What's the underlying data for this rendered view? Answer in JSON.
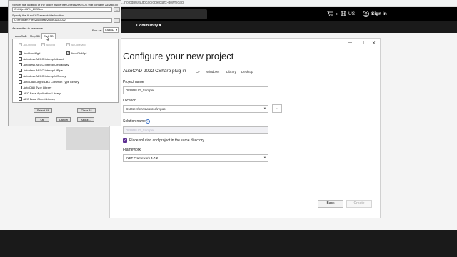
{
  "browser": {
    "url": "...nologies/autocad/objectarx-download"
  },
  "site_header": {
    "cart_count": "0",
    "region": "US",
    "signin": "Sign in",
    "nav_item": "Community ▾"
  },
  "vs_window": {
    "title": "Configure your new project",
    "template_name": "AutoCAD 2022 CSharp plug-in",
    "template_tags": [
      "C#",
      "Windows",
      "Library",
      "Desktop"
    ],
    "project_name_label": "Project name",
    "project_name_value": "DFWBIUG_Sample",
    "location_label": "Location",
    "location_value": "C:\\Users\\chris\\source\\repos",
    "browse_label": "...",
    "solution_name_label": "Solution name",
    "solution_name_value": "DFWBIUG_Sample",
    "same_dir_label": "Place solution and project in the same directory",
    "framework_label": "Framework",
    "framework_value": ".NET Framework 4.7.2",
    "back_button": "Back",
    "create_button": "Create"
  },
  "wizard": {
    "sdk_prompt": "Specify the location of the folder inside the ObjectARX SDK that contains AcMgd.dll",
    "sdk_path": "C:\\ObjectARX_2022\\inc",
    "exe_prompt": "Specify the AutoCAD executable location",
    "exe_path": "C:\\Program Files\\Autodesk\\AutoCAD 2022",
    "browse_label": "...",
    "assemblies_label": "Assemblies to reference",
    "run_as_label": "Run As:",
    "run_as_value": "Civil3D",
    "tabs": [
      "AutoCAD",
      "Map 3D",
      "Civil 3D"
    ],
    "top_refs": [
      {
        "label": "AcDbMgd",
        "checked": true,
        "grey": true
      },
      {
        "label": "AcMgd",
        "checked": true,
        "grey": true
      },
      {
        "label": "AcCoreMgd",
        "checked": true,
        "grey": true
      },
      {
        "label": "AecBaseMgd",
        "checked": true,
        "grey": false
      },
      {
        "label": "AeccDbMgd",
        "checked": true,
        "grey": false
      }
    ],
    "list_refs": [
      "Autodesk.AECC.Interop.UiLand",
      "Autodesk.AECC.Interop.UiRoadway",
      "Autodesk.AECC.Interop.UiPipe",
      "Autodesk.AECC.Interop.UiSurvey",
      "AutoCAD/ObjectDBX Common Type Library",
      "AutoCAD Type Library",
      "AEC Base Application Library",
      "AEC Base Object Library"
    ],
    "select_all": "Select All",
    "clear_all": "Clear All",
    "ok": "Ok",
    "cancel": "Cancel",
    "about": "About..."
  }
}
